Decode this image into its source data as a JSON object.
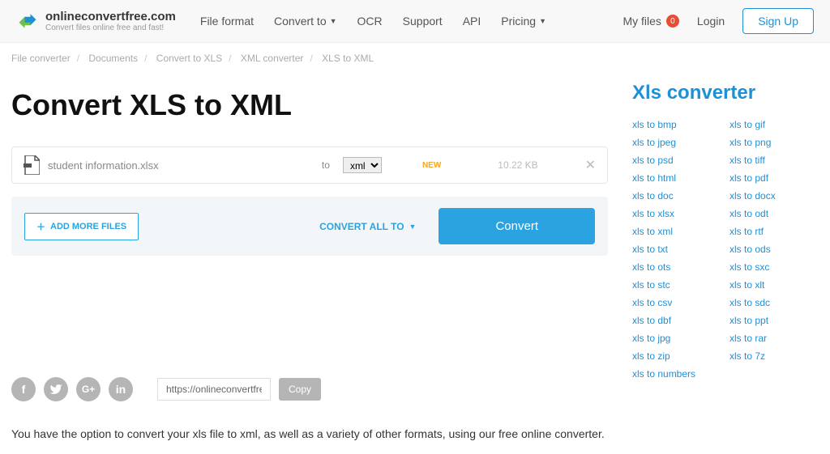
{
  "header": {
    "logo_title": "onlineconvertfree.com",
    "logo_sub": "Convert files online free and fast!",
    "nav": {
      "file_format": "File format",
      "convert_to": "Convert to",
      "ocr": "OCR",
      "support": "Support",
      "api": "API",
      "pricing": "Pricing"
    },
    "myfiles": "My files",
    "myfiles_count": "0",
    "login": "Login",
    "signup": "Sign Up"
  },
  "breadcrumb": {
    "c0": "File converter",
    "c1": "Documents",
    "c2": "Convert to XLS",
    "c3": "XML converter",
    "c4": "XLS to XML"
  },
  "page_title": "Convert XLS to XML",
  "file": {
    "name": "student information.xlsx",
    "to_label": "to",
    "format": "xml",
    "status": "NEW",
    "size": "10.22 KB"
  },
  "actions": {
    "add_more": "ADD MORE FILES",
    "convert_all": "CONVERT ALL TO",
    "convert": "Convert"
  },
  "share": {
    "url": "https://onlineconvertfree.c",
    "copy": "Copy"
  },
  "description": "You have the option to convert your xls file to xml, as well as a variety of other formats, using our free online converter.",
  "sidebar": {
    "title": "Xls converter",
    "links_left": [
      "xls to bmp",
      "xls to jpeg",
      "xls to psd",
      "xls to html",
      "xls to doc",
      "xls to xlsx",
      "xls to xml",
      "xls to txt",
      "xls to ots",
      "xls to stc",
      "xls to csv",
      "xls to dbf",
      "xls to jpg",
      "xls to zip",
      "xls to numbers"
    ],
    "links_right": [
      "xls to gif",
      "xls to png",
      "xls to tiff",
      "xls to pdf",
      "xls to docx",
      "xls to odt",
      "xls to rtf",
      "xls to ods",
      "xls to sxc",
      "xls to xlt",
      "xls to sdc",
      "xls to ppt",
      "xls to rar",
      "xls to 7z"
    ]
  }
}
